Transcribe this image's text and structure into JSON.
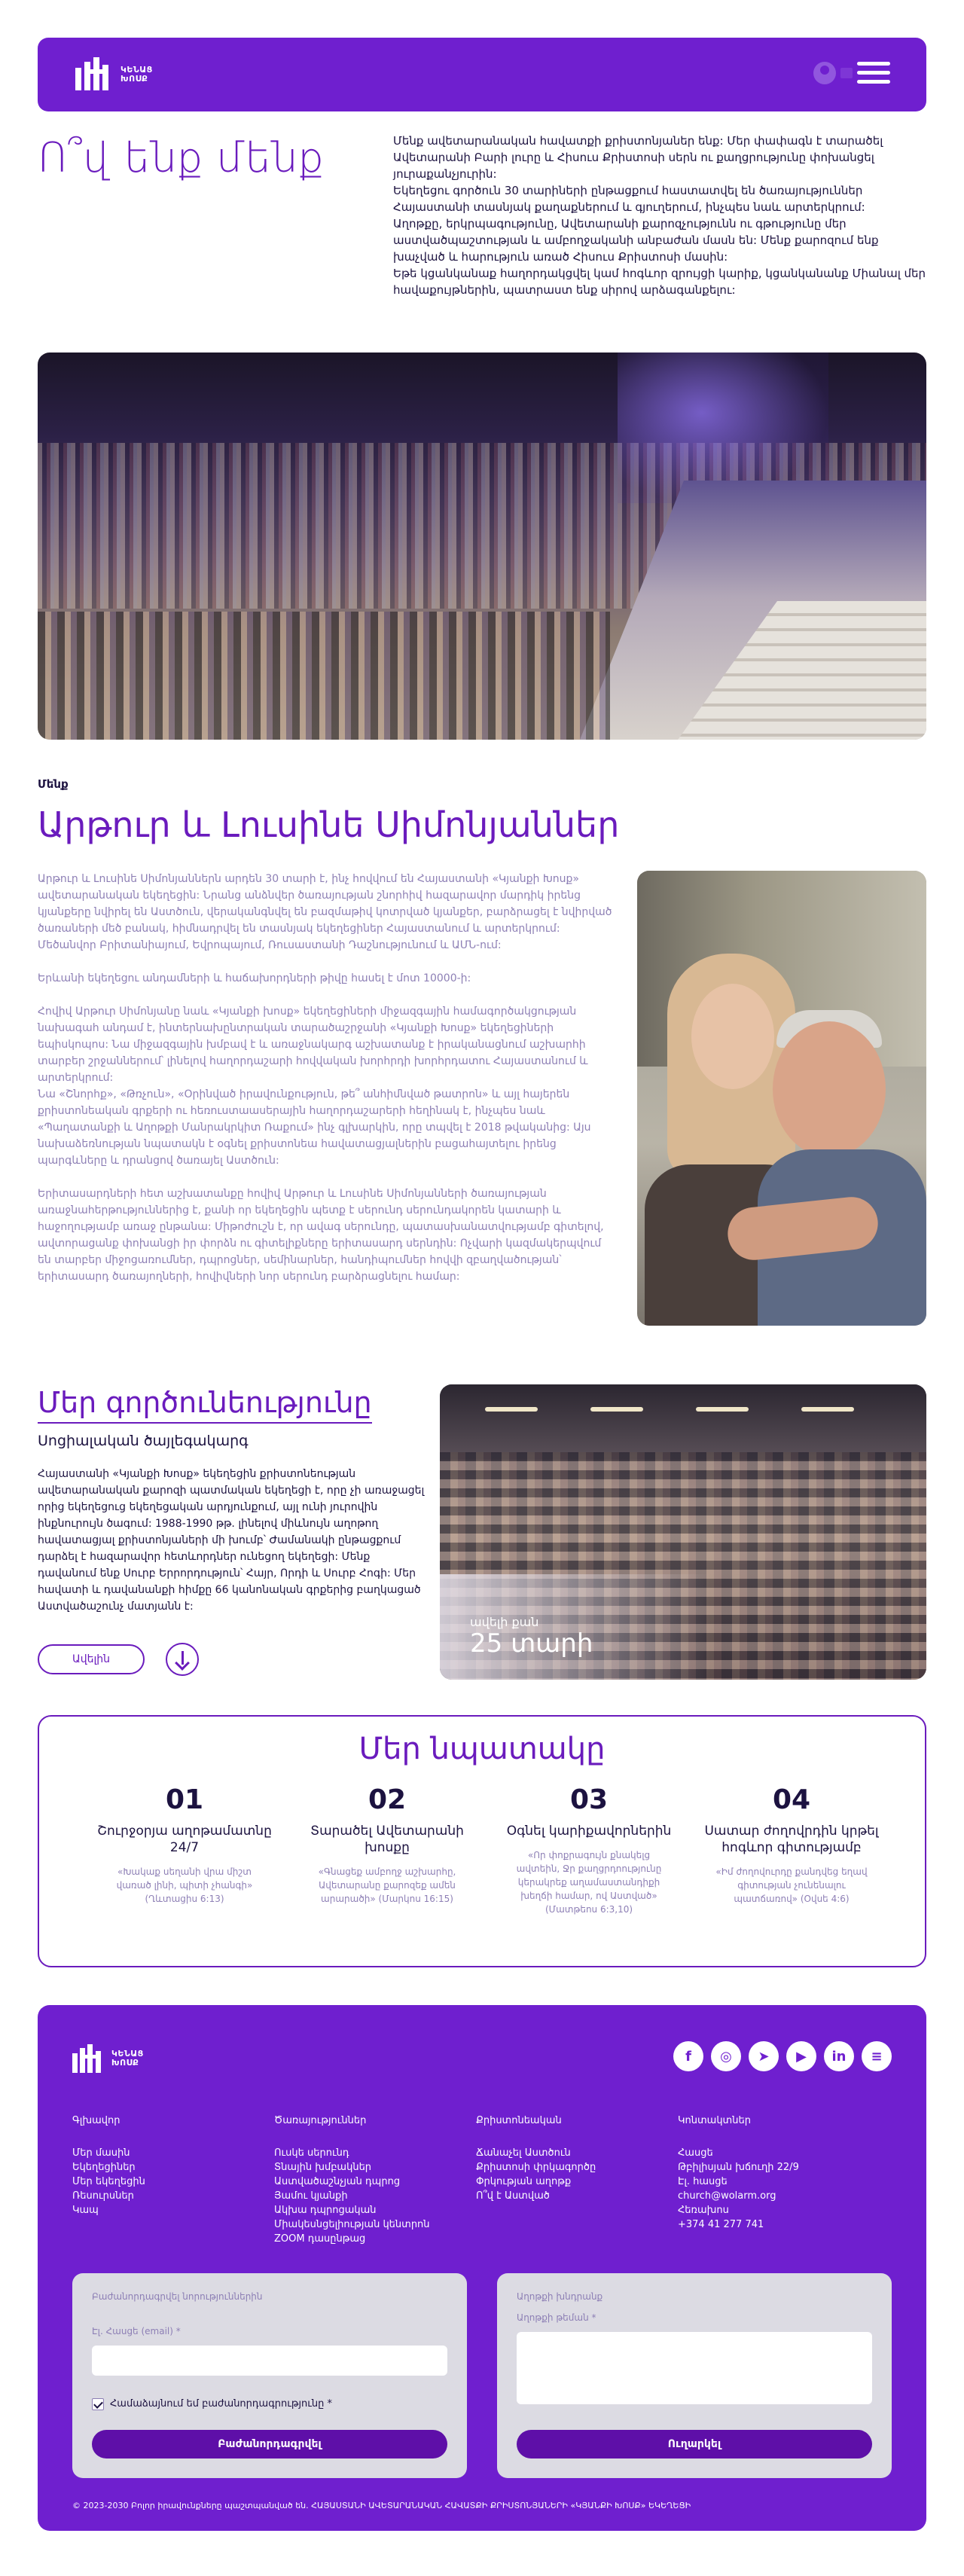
{
  "header": {
    "logo_line1": "ԿԵՆԱՑ",
    "logo_line2": "ԽՈՍՔ"
  },
  "about": {
    "title": "Ո՞վ ենք մենք",
    "lines": [
      "Մենք ավետարանական հավատքի քրիստոնյաներ ենք: Մեր փափագն է տարածել",
      "Ավետարանի Բարի լուրը և Հիսուս Քրիստոսի սերն ու քաղցրությունը փոխանցել",
      "յուրաքանչյուրին:",
      "Եկեղեցու գործուն 30 տարիների ընթացքում հաստատվել են ծառայություններ",
      "Հայաստանի տասնյակ քաղաքներում և գյուղերում, ինչպես նաև արտերկրում:",
      "Աղոթքը, երկրպագությունը, Ավետարանի քարոզչությունն ու գթությունը մեր",
      "աստվածպաշտության և ամբողջականի անբաժան մասն են: Մենք քարոզում ենք",
      "խաչված և հարություն առած Հիսուս Քրիստոսի մասին:",
      "Եթե կցանկանաք հաղորդակցվել կամ հոգևոր զրույցի կարիք, կցանկանանք Միանալ մեր",
      "հավաքույթներին, պատրաստ ենք սիրով արձագանքելու:"
    ]
  },
  "leaders": {
    "label": "Մենք",
    "title": "Արթուր և Լուսինե Սիմոնյաններ",
    "paragraphs": [
      "Արթուր և Լուսինե Սիմոնյաններն արդեն 30 տարի է, ինչ հովվում են Հայաստանի «Կյանքի Խոսք» ավետարանական եկեղեցին: Նրանց անձնվեր ծառայության շնորհիվ հազարավոր մարդիկ իրենց կյանքերը նվիրել են Աստծուն, վերականգնվել են բազմաթիվ կոտրված կյանքեր, բարձրացել է նվիրված ծառաների մեծ բանակ, հիմնադրվել են տասնյակ եկեղեցիներ Հայաստանում և արտերկրում: Մեծանվոր Բրիտանիայում, Եվրոպայում, Ռուսաստանի Դաշնությունում և ԱՄՆ-ում:",
      "Երևանի եկեղեցու անդամների և հաճախորդների թիվը հասել է մոտ 10000-ի:",
      "Հովիվ Արթուր Սիմոնյանը նաև «Կյանքի խոսք» եկեղեցիների միջազգային համագործակցության նախագահ անդամ է, ինտերնախընտրական տարածաշրջանի «Կյանքի Խոսք» եկեղեցիների եպիսկոպոս: Նա միջազգային խմբավ է և առաջնակարգ աշխատանք է իրականացնում աշխարհի տարբեր շրջաններում՝ լինելով հաղորդաշարի հովվական խորհրդի խորհրդատու Հայաստանում և արտերկրում:\nՆա «Շնորհք», «Թռչուն», «Օրինված իրավունքություն, թե՞ անհիմնված թատրոն» և այլ հայերեն քրիստոնեական գրքերի ու հեռուստաասերային հաղորդաշարերի հեղինակ է, ինչպես նաև «Պաղատանքի և Աղոթքի Մանրակրկիտ Ռաքում» ինչ գլխարկին, որը տպվել է 2018 թվականից: Այս նախաձեռնության նպատակն է օգնել քրիստոնեա հավատացյալներին բացահայտելու իրենց պարգևները և դրանցով ծառայել Աստծուն:",
      "Երիտասարդների հետ աշխատանքը հովիվ Արթուր և Լուսինե Սիմոնյանների ծառայության առաջնահերթություններից է, քանի որ եկեղեցին պետք է սերունդ սերունդակորեն կատարի և հաջողությամբ առաջ ընթանա: Միթոժուշն է, որ ավագ սերունդը, պատասխանատվությամբ գիտելով, ավտորացանք փոխանցի իր փորձն ու գիտելիքները երիտասարդ սերնդին: Ոչվարի կազմակերպվում են տարբեր միջոցառումներ, դպրոցներ, սեմինարներ, հանդիպումներ հովվի զբաղվածության՝ երիտասարդ ծառայողների, հովիվների նոր սերունդ բարձրացնելու համար:"
    ]
  },
  "activity": {
    "title": "Մեր գործունեությունը",
    "subtitle": "Սոցիալական ծայլեգակարգ",
    "text": "Հայաստանի «Կյանքի Խոսք» եկեղեցին քրիստոնեության ավետարանական քարոզի պատմական եկեղեցի է, որը չի առաջացել որից եկեղեցուց եկեղեցական արդյունքում, այլ ունի յուրովին ինքնուրույն ծագում: 1988-1990 թթ. լինելով միևնույն աղոթող հավատացյալ քրիստոնյաների մի խումբ՝ Ժամանակի ընթացքում դարձել է հազարավոր հետևորդներ ունեցող եկեղեցի: Մենք դավանում ենք Սուրբ Երրորդություն՝ Հայր, Որդի և Սուրբ Հոգի: Մեր հավատի և դավանանքի հիմքը 66 կանոնական գրքերից բաղկացած Աստվածաշունչ մատյանն է:",
    "button_label": "Ավելին",
    "photo_small": "ավելի քան",
    "photo_big": "25 տարի"
  },
  "goals": {
    "title": "Մեր նպատակը",
    "items": [
      {
        "num": "01",
        "title": "Շուրջօրյա աղոթամատնը 24/7",
        "quote": "«Խակաք սեղանի վրա միշտ վառած լինի, պիտի չհանգի» (Ղևտացիս 6:13)"
      },
      {
        "num": "02",
        "title": "Տարածել Ավետարանի խոսքը",
        "quote": "«Գնացեք ամբողջ աշխարհը, Ավետարանը քարոզեք ամեն արարածի» (Մարկոս 16:15)"
      },
      {
        "num": "03",
        "title": "Օգնել կարիքավորներին",
        "quote": "«Որ փոքրագույն քնակելց ավտեին, Ջր քաղցրդոությունը կերակրեք աղամաստանդիքի խեղճի համար, ով Աստված» (Մատթեոս 6:3,10)"
      },
      {
        "num": "04",
        "title": "Սատար ժողովրդին կրթել հոգևոր գիտությամբ",
        "quote": "«Իմ ժողովուրդը քանդվեց եղավ գիտության չունենալու պատճառով» (Օվսե 4:6)"
      }
    ]
  },
  "footer": {
    "logo_line1": "ԿԵՆԱՑ",
    "logo_line2": "ԽՈՍՔ",
    "social": [
      "f",
      "◎",
      "➤",
      "▶",
      "in",
      "≡"
    ],
    "columns": [
      {
        "title": "Գլխավոր",
        "items": [
          "Մեր մասին",
          "Եկեղեցիներ",
          "Մեր եկեղեցին",
          "Ռեսուրսներ",
          "Կապ"
        ]
      },
      {
        "title": "Ծառայություններ",
        "items": [
          "Ուսկե սերունդ",
          "Տնային խմբակներ",
          "Աստվածաշնչյան դպրոց",
          "Յամու կյանքի",
          "Ակխա դպրոցական",
          "Միակեսնցելիության կենտրոն",
          "ZOOM դասընթաց"
        ]
      },
      {
        "title": "Քրիստոնեական",
        "items": [
          "Ճանաչել Աստծուն",
          "Քրիստոսի փրկագործը",
          "Փրկության աղոթք",
          "Ո՞վ է Աստված"
        ]
      },
      {
        "title": "Կոնտակտներ",
        "items": [
          "Հասցե",
          "Թբիլիսյան խճուղի 22/9",
          "Էլ. հասցե",
          "church@wolarm.org",
          "Հեռախոս",
          "+374 41 277 741"
        ]
      }
    ],
    "newsletter": {
      "title": "Բաժանորդագրվել նորություններին",
      "email_label": "Էլ. Հասցե (email) *",
      "consent": "Համաձայնում եմ բաժանորդագրությունը *",
      "button": "Բաժանորդագրվել"
    },
    "prayer": {
      "title": "Աղոթքի խնդրանք",
      "message_label": "Աղոթքի թեման *",
      "button": "Ուղարկել"
    },
    "copyright": "© 2023-2030 Բոլոր իրավունքները պաշտպանված են. ՀԱՅԱՍՏԱՆԻ ԱՎԵՏԱՐԱՆԱԿԱՆ ՀԱՎԱՏՔԻ ՔՐԻՍՏՈՆՅԱՆԵՐԻ «ԿՅԱՆՔԻ ԽՈՍՔ» ԵԿԵՂԵՑԻ"
  },
  "colors": {
    "primary": "#6f1fcf",
    "accent_text": "#6a1bbd",
    "muted_text": "#8d7fb5"
  }
}
